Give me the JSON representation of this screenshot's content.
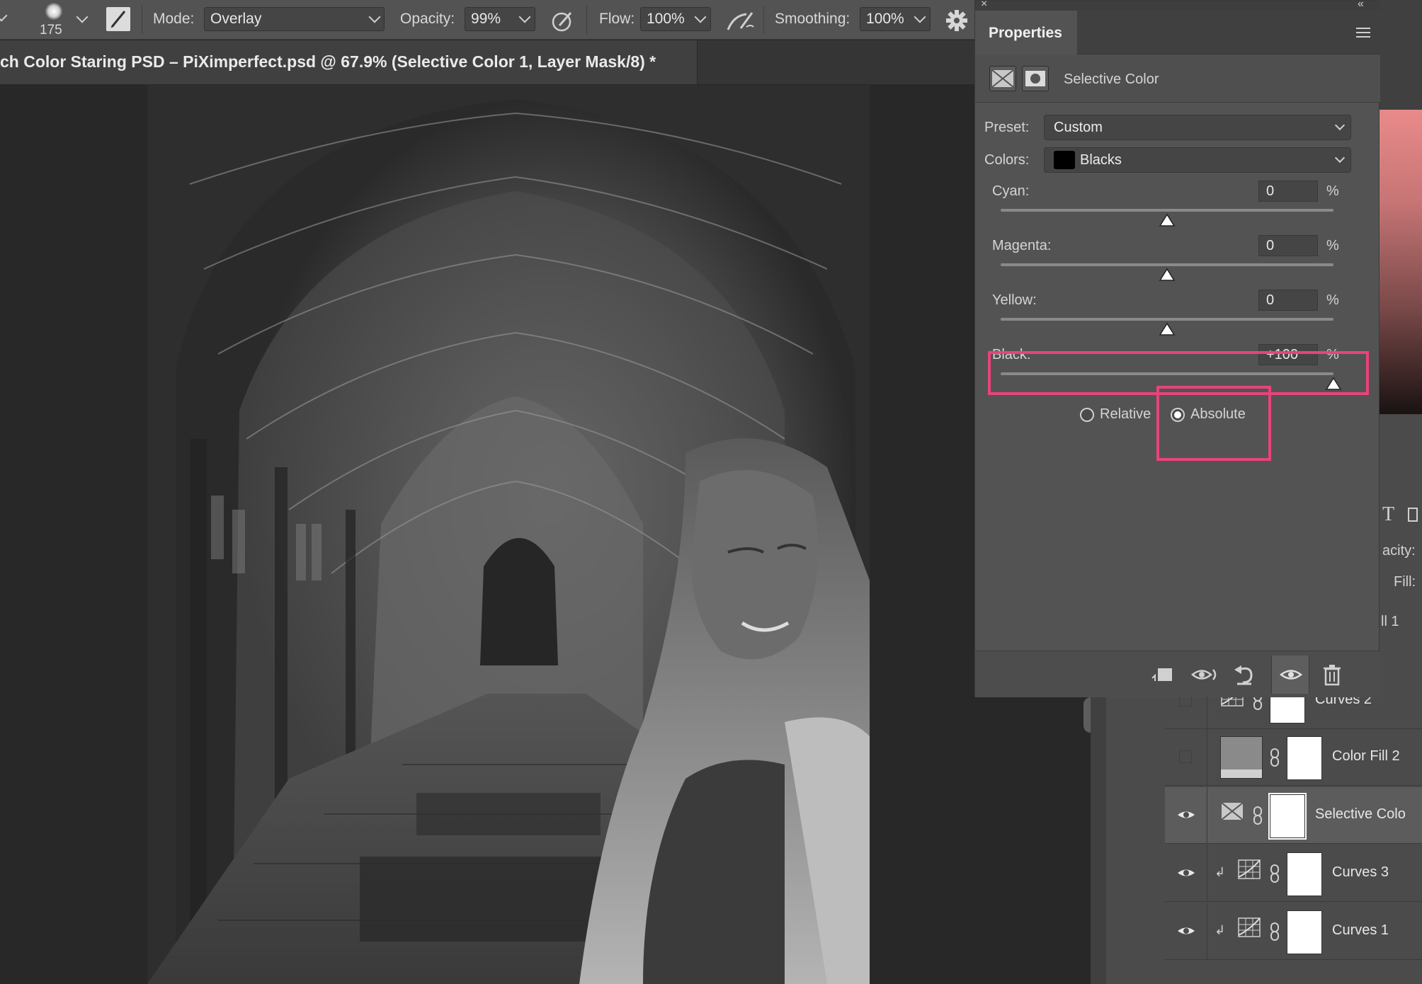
{
  "options_bar": {
    "brush_size": "175",
    "mode_label": "Mode:",
    "mode_value": "Overlay",
    "opacity_label": "Opacity:",
    "opacity_value": "99%",
    "flow_label": "Flow:",
    "flow_value": "100%",
    "smoothing_label": "Smoothing:",
    "smoothing_value": "100%"
  },
  "document": {
    "tab_title": "ch Color Staring PSD – PiXimperfect.psd @ 67.9% (Selective Color 1, Layer Mask/8) *"
  },
  "properties": {
    "tab_label": "Properties",
    "adjustment_name": "Selective Color",
    "preset_label": "Preset:",
    "preset_value": "Custom",
    "colors_label": "Colors:",
    "colors_value": "Blacks",
    "sliders": [
      {
        "label": "Cyan:",
        "value": "0",
        "unit": "%",
        "position": 0.5
      },
      {
        "label": "Magenta:",
        "value": "0",
        "unit": "%",
        "position": 0.5
      },
      {
        "label": "Yellow:",
        "value": "0",
        "unit": "%",
        "position": 0.5
      },
      {
        "label": "Black:",
        "value": "+100",
        "unit": "%",
        "position": 1.0
      }
    ],
    "method_options": [
      {
        "label": "Relative",
        "selected": false
      },
      {
        "label": "Absolute",
        "selected": true
      }
    ],
    "highlight_color": "#e8437a"
  },
  "right_panel": {
    "opacity_fragment": "acity:",
    "fill_label": "Fill:",
    "layer_fragment": "ll 1"
  },
  "layers": [
    {
      "name": "Curves 2",
      "visible": false,
      "type": "curves",
      "clipped": false
    },
    {
      "name": "Color Fill 2",
      "visible": false,
      "type": "fill",
      "clipped": false
    },
    {
      "name": "Selective Colo",
      "visible": true,
      "type": "selective-color",
      "clipped": false,
      "selected": true
    },
    {
      "name": "Curves 3",
      "visible": true,
      "type": "curves",
      "clipped": true
    },
    {
      "name": "Curves 1",
      "visible": true,
      "type": "curves",
      "clipped": true
    }
  ]
}
